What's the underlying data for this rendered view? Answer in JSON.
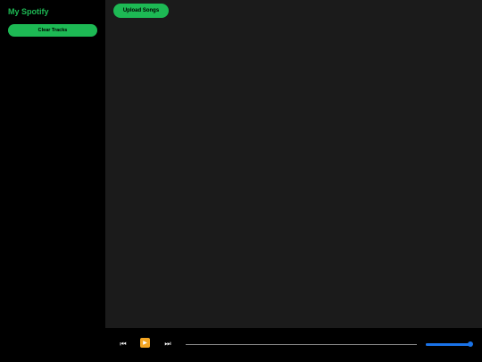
{
  "sidebar": {
    "title": "My Spotify",
    "clear_label": "Clear Tracks"
  },
  "main": {
    "upload_label": "Upload Songs",
    "tracks": []
  },
  "player": {
    "prev_icon": "⏮",
    "play_icon": "▶",
    "next_icon": "⏭",
    "progress_fraction": 0,
    "volume_fraction": 1
  },
  "colors": {
    "accent": "#1db954",
    "main_bg": "#1b1b1b",
    "sidebar_bg": "#000000",
    "volume": "#1a73e8",
    "play_button": "#f5a623"
  }
}
